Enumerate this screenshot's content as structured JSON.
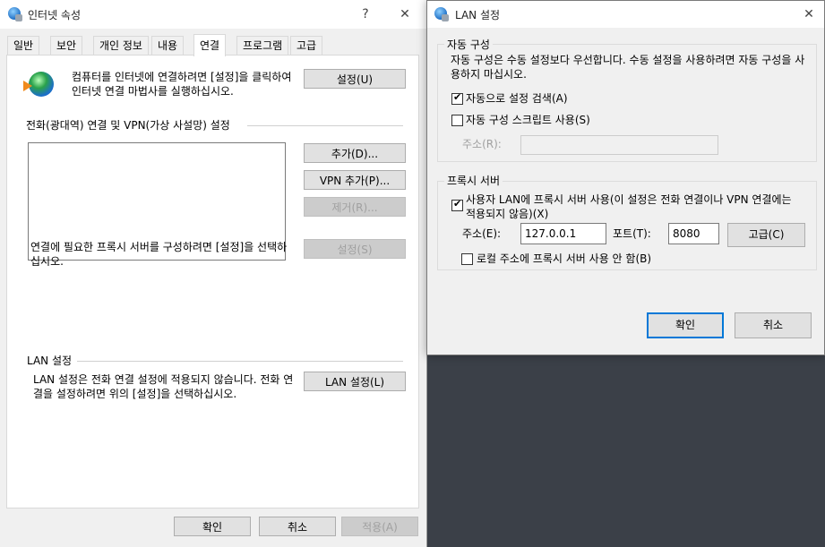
{
  "internet_options": {
    "title": "인터넷 속성",
    "help_glyph": "?",
    "close_glyph": "✕",
    "tabs": [
      "일반",
      "보안",
      "개인 정보",
      "내용",
      "연결",
      "프로그램",
      "고급"
    ],
    "active_tab": "연결",
    "setup": {
      "text": "컴퓨터를 인터넷에 연결하려면 [설정]을 클릭하여 인터넷 연결 마법사를 실행하십시오.",
      "button": "설정(U)"
    },
    "dialup": {
      "heading": "전화(광대역) 연결 및 VPN(가상 사설망) 설정",
      "add_button": "추가(D)...",
      "add_vpn_button": "VPN 추가(P)...",
      "remove_button": "제거(R)...",
      "proxy_text": "연결에 필요한 프록시 서버를 구성하려면 [설정]을 선택하십시오.",
      "settings_button": "설정(S)"
    },
    "lan": {
      "heading": "LAN 설정",
      "text": "LAN 설정은 전화 연결 설정에 적용되지 않습니다. 전화 연결을 설정하려면 위의 [설정]을 선택하십시오.",
      "button": "LAN 설정(L)"
    },
    "footer": {
      "ok": "확인",
      "cancel": "취소",
      "apply": "적용(A)"
    }
  },
  "lan_dialog": {
    "title": "LAN 설정",
    "close_glyph": "✕",
    "auto_config": {
      "heading": "자동 구성",
      "description": "자동 구성은 수동 설정보다 우선합니다. 수동 설정을 사용하려면 자동 구성을 사용하지 마십시오.",
      "auto_detect_label": "자동으로 설정 검색(A)",
      "auto_detect_checked": true,
      "script_label": "자동 구성 스크립트 사용(S)",
      "script_checked": false,
      "address_label": "주소(R):",
      "address_value": ""
    },
    "proxy": {
      "heading": "프록시 서버",
      "use_proxy_label": "사용자 LAN에 프록시 서버 사용(이 설정은 전화 연결이나 VPN 연결에는 적용되지 않음)(X)",
      "use_proxy_checked": true,
      "address_label": "주소(E):",
      "address_value": "127.0.0.1",
      "port_label": "포트(T):",
      "port_value": "8080",
      "advanced_button": "고급(C)",
      "bypass_label": "로컬 주소에 프록시 서버 사용 안 함(B)",
      "bypass_checked": false
    },
    "ok": "확인",
    "cancel": "취소"
  }
}
